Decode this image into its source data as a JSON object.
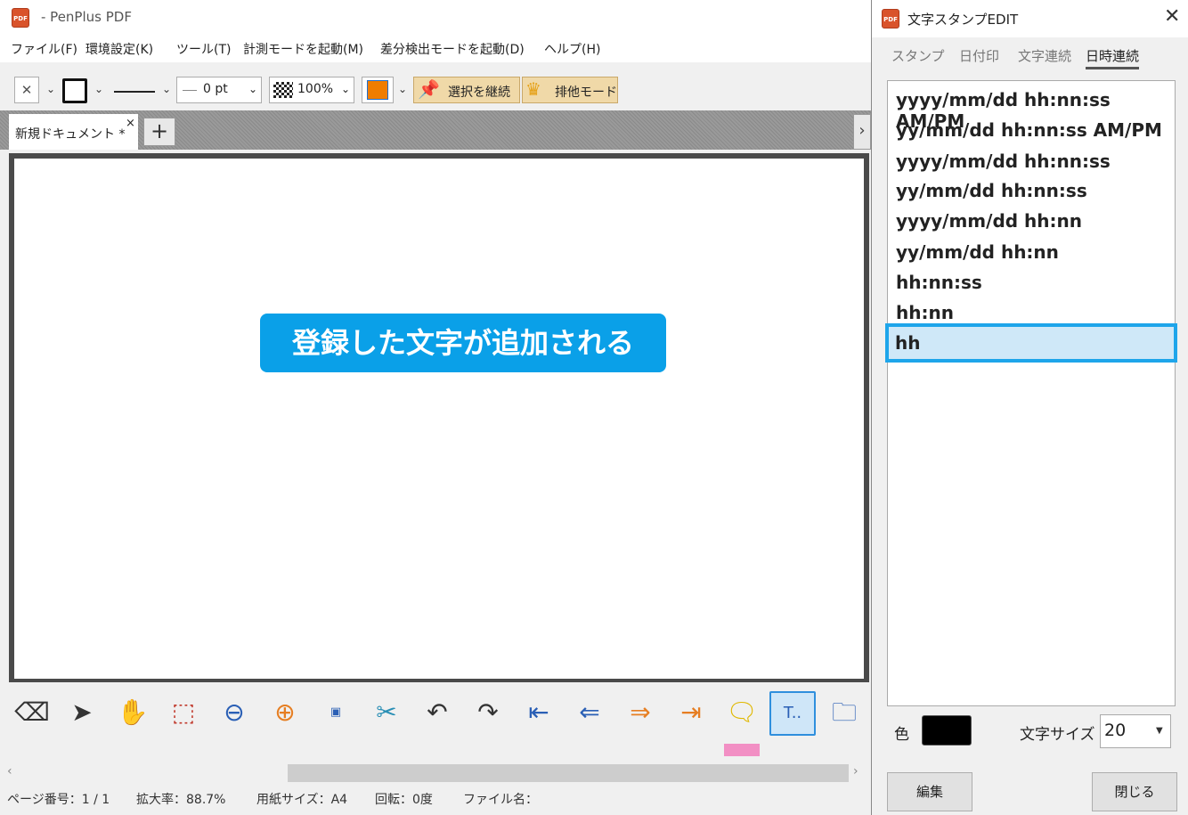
{
  "app": {
    "title": "- PenPlus PDF"
  },
  "menu": [
    "ファイル(F)",
    "環境設定(K)",
    "ツール(T)",
    "計測モードを起動(M)",
    "差分検出モードを起動(D)",
    "ヘルプ(H)"
  ],
  "toolbar": {
    "close_glyph": "✕",
    "line_width": "0 pt",
    "opacity": "100%",
    "continue_selection": "選択を継続",
    "exclusive_mode": "排他モード"
  },
  "document": {
    "tab_label": "新規ドキュメント *",
    "tab_close": "×",
    "new_tab": "+",
    "scroll_right": "›",
    "callout": "登録した文字が追加される"
  },
  "status": {
    "page": "ページ番号：1 / 1",
    "zoom": "拡大率：88.7%",
    "paper": "用紙サイズ：A4",
    "rotation": "回転：0度",
    "filename": "ファイル名："
  },
  "panel": {
    "title": "文字スタンプEDIT",
    "close": "✕",
    "tabs": [
      "スタンプ",
      "日付印",
      "文字連続",
      "日時連続"
    ],
    "active_tab": "日時連続",
    "formats": [
      "yyyy/mm/dd hh:nn:ss AM/PM",
      "yy/mm/dd hh:nn:ss AM/PM",
      "yyyy/mm/dd hh:nn:ss",
      "yy/mm/dd hh:nn:ss",
      "yyyy/mm/dd hh:nn",
      "yy/mm/dd hh:nn",
      "hh:nn:ss",
      "hh:nn",
      "hh"
    ],
    "selected_format": "hh",
    "color_label": "色",
    "color_value": "#000000",
    "size_label": "文字サイズ",
    "size_value": "20",
    "edit_button": "編集",
    "close_button": "閉じる"
  },
  "colors": {
    "accent": "#0aa0e8",
    "selection": "#1ea5ea",
    "fill_swatch": "#f07d00",
    "pink_swatch": "#f28fc4"
  }
}
